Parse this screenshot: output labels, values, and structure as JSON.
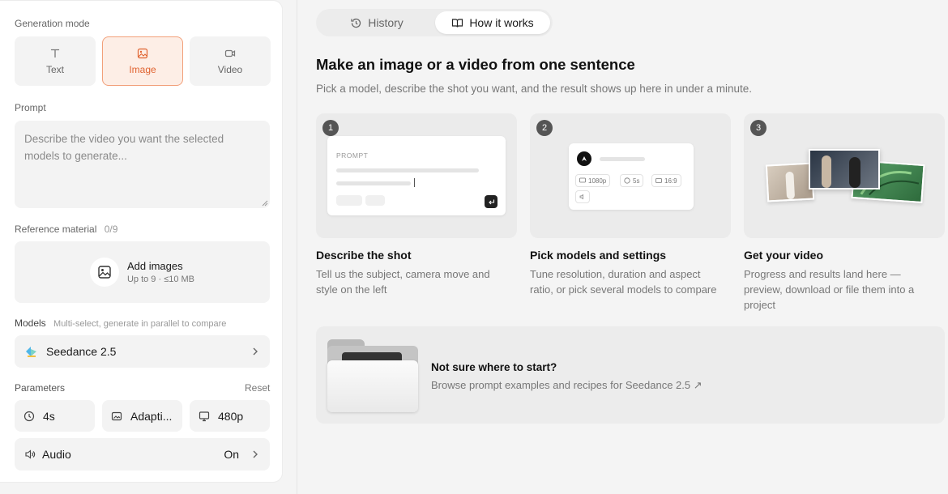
{
  "left": {
    "mode_label": "Generation mode",
    "modes": [
      {
        "label": "Text",
        "icon": "text-icon"
      },
      {
        "label": "Image",
        "icon": "image-icon",
        "active": true
      },
      {
        "label": "Video",
        "icon": "video-icon"
      }
    ],
    "prompt_label": "Prompt",
    "prompt_placeholder": "Describe the video you want the selected models to generate...",
    "ref_label": "Reference material",
    "ref_count": "0/9",
    "add_images_title": "Add images",
    "add_images_sub": "Up to 9 · ≤10 MB",
    "models_label": "Models",
    "models_hint": "Multi-select, generate in parallel to compare",
    "model_name": "Seedance 2.5",
    "params_label": "Parameters",
    "reset_label": "Reset",
    "params": [
      {
        "value": "4s",
        "icon": "clock-icon"
      },
      {
        "value": "Adapti...",
        "icon": "aspect-ratio-icon"
      },
      {
        "value": "480p",
        "icon": "monitor-icon"
      }
    ],
    "audio_label": "Audio",
    "audio_value": "On"
  },
  "tabs": [
    {
      "label": "History",
      "icon": "history-icon"
    },
    {
      "label": "How it works",
      "icon": "book-icon",
      "active": true
    }
  ],
  "main": {
    "title": "Make an image or a video from one sentence",
    "subtitle": "Pick a model, describe the shot you want, and the result shows up here in under a minute.",
    "steps": [
      {
        "num": "1",
        "title": "Describe the shot",
        "desc": "Tell us the subject, camera move and style on the left",
        "mock_label": "PROMPT"
      },
      {
        "num": "2",
        "title": "Pick models and settings",
        "desc": "Tune resolution, duration and aspect ratio, or pick several models to compare",
        "pills": [
          "1080p",
          "5s",
          "16:9"
        ]
      },
      {
        "num": "3",
        "title": "Get your video",
        "desc": "Progress and results land here — preview, download or file them into a project"
      }
    ],
    "banner_title": "Not sure where to start?",
    "banner_sub": "Browse prompt examples and recipes for Seedance 2.5 ↗"
  },
  "colors": {
    "accent": "#e0622f",
    "accent_bg": "#fdeee6",
    "panel": "#f3f3f3"
  }
}
